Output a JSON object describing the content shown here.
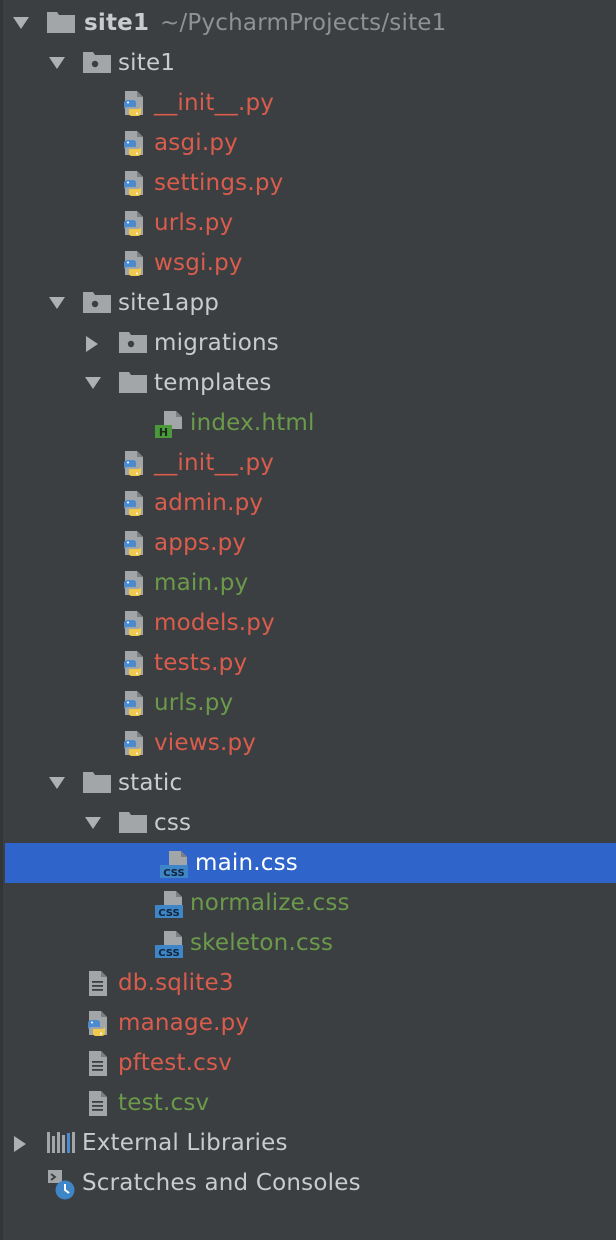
{
  "root": {
    "name": "site1",
    "path": "~/PycharmProjects/site1"
  },
  "rows": [
    {
      "label": "site1",
      "icon": "package-folder-icon",
      "color": "plain",
      "arrow": "down"
    },
    {
      "label": "__init__.py",
      "icon": "python-file-icon",
      "color": "red"
    },
    {
      "label": "asgi.py",
      "icon": "python-file-icon",
      "color": "red"
    },
    {
      "label": "settings.py",
      "icon": "python-file-icon",
      "color": "red"
    },
    {
      "label": "urls.py",
      "icon": "python-file-icon",
      "color": "red"
    },
    {
      "label": "wsgi.py",
      "icon": "python-file-icon",
      "color": "red"
    },
    {
      "label": "site1app",
      "icon": "package-folder-icon",
      "color": "plain",
      "arrow": "down"
    },
    {
      "label": "migrations",
      "icon": "package-folder-icon",
      "color": "plain",
      "arrow": "right"
    },
    {
      "label": "templates",
      "icon": "folder-icon",
      "color": "plain",
      "arrow": "down"
    },
    {
      "label": "index.html",
      "icon": "html-file-icon",
      "color": "green"
    },
    {
      "label": "__init__.py",
      "icon": "python-file-icon",
      "color": "red"
    },
    {
      "label": "admin.py",
      "icon": "python-file-icon",
      "color": "red"
    },
    {
      "label": "apps.py",
      "icon": "python-file-icon",
      "color": "red"
    },
    {
      "label": "main.py",
      "icon": "python-file-icon",
      "color": "green"
    },
    {
      "label": "models.py",
      "icon": "python-file-icon",
      "color": "red"
    },
    {
      "label": "tests.py",
      "icon": "python-file-icon",
      "color": "red"
    },
    {
      "label": "urls.py",
      "icon": "python-file-icon",
      "color": "green"
    },
    {
      "label": "views.py",
      "icon": "python-file-icon",
      "color": "red"
    },
    {
      "label": "static",
      "icon": "folder-icon",
      "color": "plain",
      "arrow": "down"
    },
    {
      "label": "css",
      "icon": "folder-icon",
      "color": "plain",
      "arrow": "down"
    },
    {
      "label": "main.css",
      "icon": "css-file-icon",
      "color": "selected",
      "selected": true
    },
    {
      "label": "normalize.css",
      "icon": "css-file-icon",
      "color": "green"
    },
    {
      "label": "skeleton.css",
      "icon": "css-file-icon",
      "color": "green"
    },
    {
      "label": "db.sqlite3",
      "icon": "text-file-icon",
      "color": "red"
    },
    {
      "label": "manage.py",
      "icon": "python-file-icon",
      "color": "red"
    },
    {
      "label": "pftest.csv",
      "icon": "text-file-icon",
      "color": "red"
    },
    {
      "label": "test.csv",
      "icon": "text-file-icon",
      "color": "green"
    },
    {
      "label": "External Libraries",
      "icon": "libraries-icon",
      "color": "plain",
      "arrow": "right"
    },
    {
      "label": "Scratches and Consoles",
      "icon": "scratches-icon",
      "color": "plain"
    }
  ],
  "icon_badges": {
    "html": "H",
    "css": "CSS"
  },
  "colors": {
    "background": "#3c3f41",
    "selection": "#2f65ca",
    "unversioned": "#d95c4c",
    "added": "#6a9a4a",
    "default_text": "#c9ccce"
  }
}
